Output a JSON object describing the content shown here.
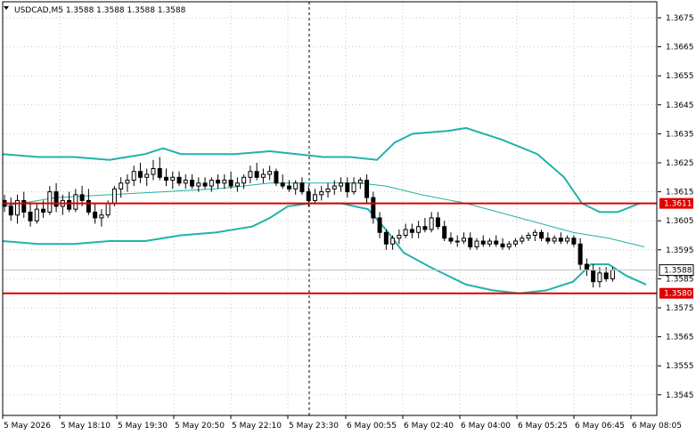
{
  "header": {
    "menu_icon": "triangle-down-icon",
    "symbol_info": "USDCAD,M5  1.3588 1.3588 1.3588 1.3588"
  },
  "colors": {
    "background": "#ffffff",
    "grid": "#c8c8c8",
    "candle_bull_body": "#ffffff",
    "candle_bear_body": "#000000",
    "candle_outline": "#000000",
    "bollinger": "#20b2aa",
    "level_line": "#e00000",
    "level_tag_bg": "#e00000",
    "level_tag_text": "#ffffff",
    "bid_line": "#c0c0c0",
    "bid_tag_bg": "#ffffff",
    "bid_tag_border": "#000000",
    "separator": "#000000"
  },
  "price_axis": {
    "labels": [
      "1.3675",
      "1.3665",
      "1.3655",
      "1.3645",
      "1.3635",
      "1.3625",
      "1.3615",
      "1.3605",
      "1.3595",
      "1.3585",
      "1.3575",
      "1.3565",
      "1.3555",
      "1.3545"
    ]
  },
  "time_axis": {
    "labels": [
      "5 May 2026",
      "5 May 18:10",
      "5 May 19:30",
      "5 May 20:50",
      "5 May 22:10",
      "5 May 23:30",
      "6 May 00:55",
      "6 May 02:40",
      "6 May 04:00",
      "6 May 05:25",
      "6 May 06:45",
      "6 May 08:05"
    ]
  },
  "levels": [
    {
      "name": "resistance",
      "price": 1.3611,
      "label": "1.3611"
    },
    {
      "name": "support",
      "price": 1.358,
      "label": "1.3580"
    }
  ],
  "bid": {
    "price": 1.3588,
    "label": "1.3588"
  },
  "chart_data": {
    "type": "candlestick",
    "symbol": "USDCAD",
    "timeframe": "M5",
    "ylim": [
      1.354,
      1.368
    ],
    "x_ticks": [
      "5 May 2026",
      "5 May 18:10",
      "5 May 19:30",
      "5 May 20:50",
      "5 May 22:10",
      "5 May 23:30",
      "6 May 00:55",
      "6 May 02:40",
      "6 May 04:00",
      "6 May 05:25",
      "6 May 06:45",
      "6 May 08:05"
    ],
    "candles": [
      [
        1.3612,
        1.3614,
        1.3608,
        1.361
      ],
      [
        1.361,
        1.3613,
        1.3605,
        1.3607
      ],
      [
        1.3607,
        1.3614,
        1.3604,
        1.3612
      ],
      [
        1.3612,
        1.3615,
        1.3606,
        1.3608
      ],
      [
        1.3608,
        1.3611,
        1.3603,
        1.3605
      ],
      [
        1.3605,
        1.3611,
        1.3604,
        1.3609
      ],
      [
        1.3609,
        1.3612,
        1.3606,
        1.3608
      ],
      [
        1.3608,
        1.3617,
        1.3607,
        1.3615
      ],
      [
        1.3615,
        1.3618,
        1.3608,
        1.361
      ],
      [
        1.361,
        1.3614,
        1.3607,
        1.3612
      ],
      [
        1.3612,
        1.3615,
        1.3608,
        1.3609
      ],
      [
        1.3609,
        1.3616,
        1.3608,
        1.3614
      ],
      [
        1.3614,
        1.3617,
        1.361,
        1.3612
      ],
      [
        1.3612,
        1.3616,
        1.3607,
        1.3608
      ],
      [
        1.3608,
        1.3611,
        1.3604,
        1.3606
      ],
      [
        1.3606,
        1.3609,
        1.3603,
        1.3607
      ],
      [
        1.3607,
        1.3612,
        1.3606,
        1.3611
      ],
      [
        1.3611,
        1.3617,
        1.361,
        1.3616
      ],
      [
        1.3616,
        1.362,
        1.3613,
        1.3618
      ],
      [
        1.3618,
        1.3621,
        1.3615,
        1.3619
      ],
      [
        1.3619,
        1.3624,
        1.3617,
        1.3622
      ],
      [
        1.3622,
        1.3625,
        1.3618,
        1.362
      ],
      [
        1.362,
        1.3623,
        1.3617,
        1.3621
      ],
      [
        1.3621,
        1.3626,
        1.3619,
        1.3623
      ],
      [
        1.3623,
        1.3627,
        1.3619,
        1.362
      ],
      [
        1.362,
        1.3623,
        1.3617,
        1.3619
      ],
      [
        1.3619,
        1.3622,
        1.3616,
        1.362
      ],
      [
        1.362,
        1.3622,
        1.3617,
        1.3618
      ],
      [
        1.3618,
        1.3621,
        1.3616,
        1.3619
      ],
      [
        1.3619,
        1.3621,
        1.3616,
        1.3617
      ],
      [
        1.3617,
        1.362,
        1.3615,
        1.3618
      ],
      [
        1.3618,
        1.362,
        1.3616,
        1.3617
      ],
      [
        1.3617,
        1.362,
        1.3615,
        1.3619
      ],
      [
        1.3619,
        1.3621,
        1.3616,
        1.3618
      ],
      [
        1.3618,
        1.3621,
        1.3616,
        1.3619
      ],
      [
        1.3619,
        1.3622,
        1.3616,
        1.3617
      ],
      [
        1.3617,
        1.362,
        1.3615,
        1.3618
      ],
      [
        1.3618,
        1.3621,
        1.3616,
        1.362
      ],
      [
        1.362,
        1.3624,
        1.3618,
        1.3622
      ],
      [
        1.3622,
        1.3625,
        1.3619,
        1.362
      ],
      [
        1.362,
        1.3623,
        1.3618,
        1.3621
      ],
      [
        1.3621,
        1.3624,
        1.3619,
        1.3622
      ],
      [
        1.3622,
        1.3623,
        1.3617,
        1.3618
      ],
      [
        1.3618,
        1.3621,
        1.3616,
        1.3617
      ],
      [
        1.3617,
        1.3619,
        1.3615,
        1.3616
      ],
      [
        1.3616,
        1.3619,
        1.3614,
        1.3618
      ],
      [
        1.3618,
        1.362,
        1.3614,
        1.3615
      ],
      [
        1.3615,
        1.3617,
        1.361,
        1.3612
      ],
      [
        1.3612,
        1.3616,
        1.3611,
        1.3614
      ],
      [
        1.3614,
        1.3617,
        1.3612,
        1.3615
      ],
      [
        1.3615,
        1.3618,
        1.3613,
        1.3616
      ],
      [
        1.3616,
        1.3619,
        1.3614,
        1.3617
      ],
      [
        1.3617,
        1.362,
        1.3615,
        1.3618
      ],
      [
        1.3618,
        1.362,
        1.3613,
        1.3615
      ],
      [
        1.3615,
        1.362,
        1.3614,
        1.3618
      ],
      [
        1.3618,
        1.362,
        1.3616,
        1.3619
      ],
      [
        1.3619,
        1.3621,
        1.3611,
        1.3613
      ],
      [
        1.3613,
        1.3615,
        1.3604,
        1.3606
      ],
      [
        1.3606,
        1.3608,
        1.3599,
        1.3601
      ],
      [
        1.3601,
        1.3602,
        1.3595,
        1.3597
      ],
      [
        1.3597,
        1.36,
        1.3595,
        1.3599
      ],
      [
        1.3599,
        1.3602,
        1.3597,
        1.36
      ],
      [
        1.36,
        1.3604,
        1.3599,
        1.3602
      ],
      [
        1.3602,
        1.3604,
        1.3599,
        1.3601
      ],
      [
        1.3601,
        1.3605,
        1.3599,
        1.3603
      ],
      [
        1.3603,
        1.3606,
        1.3601,
        1.3602
      ],
      [
        1.3602,
        1.3608,
        1.3601,
        1.3606
      ],
      [
        1.3606,
        1.3608,
        1.3602,
        1.3603
      ],
      [
        1.3603,
        1.3605,
        1.3598,
        1.3599
      ],
      [
        1.3599,
        1.3601,
        1.3597,
        1.3598
      ],
      [
        1.3598,
        1.36,
        1.3596,
        1.3598
      ],
      [
        1.3598,
        1.3601,
        1.3597,
        1.3599
      ],
      [
        1.3599,
        1.3601,
        1.3595,
        1.3596
      ],
      [
        1.3596,
        1.3599,
        1.3595,
        1.3598
      ],
      [
        1.3598,
        1.36,
        1.3596,
        1.3597
      ],
      [
        1.3597,
        1.3599,
        1.3596,
        1.3598
      ],
      [
        1.3598,
        1.36,
        1.3596,
        1.3597
      ],
      [
        1.3597,
        1.3599,
        1.3595,
        1.3596
      ],
      [
        1.3596,
        1.3598,
        1.3595,
        1.3597
      ],
      [
        1.3597,
        1.3599,
        1.3596,
        1.3598
      ],
      [
        1.3598,
        1.36,
        1.3597,
        1.3599
      ],
      [
        1.3599,
        1.3601,
        1.3598,
        1.36
      ],
      [
        1.36,
        1.3602,
        1.3598,
        1.3601
      ],
      [
        1.3601,
        1.3602,
        1.3598,
        1.3599
      ],
      [
        1.3599,
        1.3601,
        1.3597,
        1.3598
      ],
      [
        1.3598,
        1.36,
        1.3597,
        1.3599
      ],
      [
        1.3599,
        1.3601,
        1.3597,
        1.3598
      ],
      [
        1.3598,
        1.36,
        1.3597,
        1.3599
      ],
      [
        1.3599,
        1.36,
        1.3596,
        1.3597
      ],
      [
        1.3597,
        1.3599,
        1.3588,
        1.359
      ],
      [
        1.359,
        1.3592,
        1.3586,
        1.3588
      ],
      [
        1.3588,
        1.359,
        1.3582,
        1.3584
      ],
      [
        1.3584,
        1.3589,
        1.3582,
        1.3587
      ],
      [
        1.3587,
        1.3589,
        1.3584,
        1.3585
      ],
      [
        1.3585,
        1.3589,
        1.3584,
        1.3588
      ]
    ],
    "bollinger": {
      "upper": [
        [
          0,
          1.3628
        ],
        [
          40,
          1.3627
        ],
        [
          80,
          1.3627
        ],
        [
          120,
          1.3626
        ],
        [
          160,
          1.3628
        ],
        [
          180,
          1.363
        ],
        [
          200,
          1.3628
        ],
        [
          260,
          1.3628
        ],
        [
          300,
          1.3629
        ],
        [
          330,
          1.3628
        ],
        [
          360,
          1.3627
        ],
        [
          390,
          1.3627
        ],
        [
          420,
          1.3626
        ],
        [
          440,
          1.3632
        ],
        [
          460,
          1.3635
        ],
        [
          500,
          1.3636
        ],
        [
          520,
          1.3637
        ],
        [
          560,
          1.3633
        ],
        [
          600,
          1.3628
        ],
        [
          630,
          1.362
        ],
        [
          650,
          1.3611
        ],
        [
          670,
          1.3608
        ],
        [
          690,
          1.3608
        ],
        [
          715,
          1.3611
        ]
      ],
      "middle": [
        [
          0,
          1.361
        ],
        [
          60,
          1.3613
        ],
        [
          120,
          1.3614
        ],
        [
          180,
          1.3615
        ],
        [
          240,
          1.3616
        ],
        [
          300,
          1.3618
        ],
        [
          345,
          1.3618
        ],
        [
          400,
          1.3618
        ],
        [
          430,
          1.3617
        ],
        [
          470,
          1.3614
        ],
        [
          520,
          1.3611
        ],
        [
          580,
          1.3606
        ],
        [
          640,
          1.3601
        ],
        [
          680,
          1.3599
        ],
        [
          720,
          1.3596
        ]
      ],
      "lower": [
        [
          0,
          1.3598
        ],
        [
          40,
          1.3597
        ],
        [
          80,
          1.3597
        ],
        [
          120,
          1.3598
        ],
        [
          160,
          1.3598
        ],
        [
          200,
          1.36
        ],
        [
          240,
          1.3601
        ],
        [
          280,
          1.3603
        ],
        [
          300,
          1.3606
        ],
        [
          320,
          1.361
        ],
        [
          345,
          1.3611
        ],
        [
          380,
          1.3611
        ],
        [
          410,
          1.3609
        ],
        [
          430,
          1.3602
        ],
        [
          450,
          1.3594
        ],
        [
          480,
          1.3589
        ],
        [
          520,
          1.3583
        ],
        [
          550,
          1.3581
        ],
        [
          580,
          1.358
        ],
        [
          610,
          1.3581
        ],
        [
          640,
          1.3584
        ],
        [
          660,
          1.359
        ],
        [
          680,
          1.359
        ],
        [
          700,
          1.3586
        ],
        [
          722,
          1.3583
        ]
      ]
    },
    "levels": [
      1.3611,
      1.358
    ],
    "grid": true
  }
}
